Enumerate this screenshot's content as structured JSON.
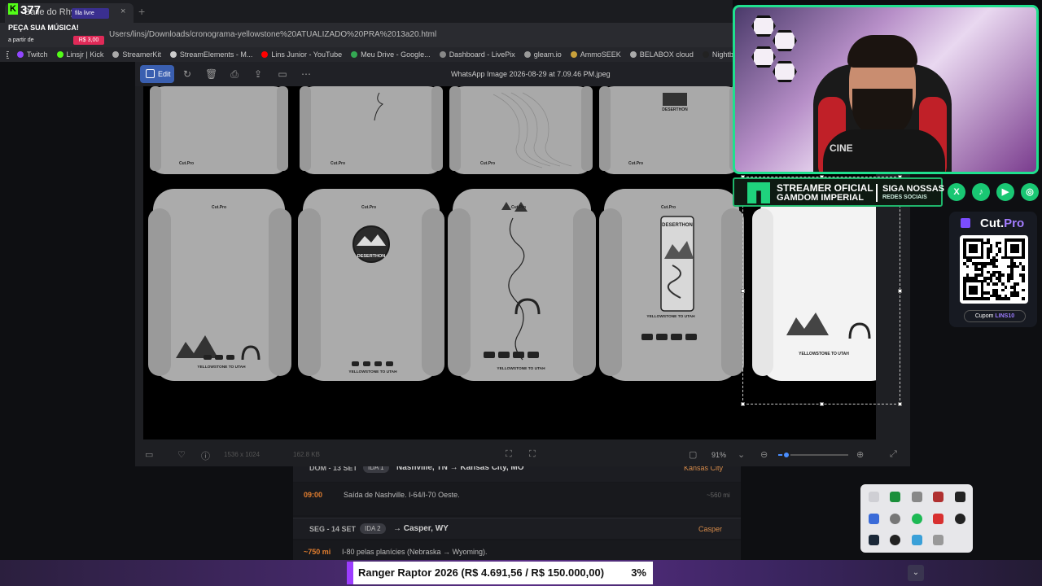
{
  "browser": {
    "tab_title": "Baile do Rhyno",
    "tab_close": "×",
    "tab_add": "+",
    "url": "Users/linsj/Downloads/cronograma-yellowstone%20ATUALIZADO%20PRA%2013a20.html",
    "bookmarks": [
      {
        "label": "Twitch",
        "color": "#9146ff"
      },
      {
        "label": "Linsjr | Kick",
        "color": "#53fc18"
      },
      {
        "label": "StreamerKit",
        "color": "#aaaaaa"
      },
      {
        "label": "StreamElements - M...",
        "color": "#cccccc"
      },
      {
        "label": "Lins Junior - YouTube",
        "color": "#ff0000"
      },
      {
        "label": "Meu Drive - Google...",
        "color": "#34a853"
      },
      {
        "label": "Dashboard - LivePix",
        "color": "#888888"
      },
      {
        "label": "gleam.io",
        "color": "#999999"
      },
      {
        "label": "AmmoSEEK",
        "color": "#c9a13b"
      },
      {
        "label": "BELABOX cloud",
        "color": "#aaaaaa"
      },
      {
        "label": "Nightbot - Comm...",
        "color": "#222222"
      }
    ]
  },
  "viewer": {
    "edit_label": "Edit",
    "title": "WhatsApp Image 2026-08-29 at 7.09.46 PM.jpeg",
    "dimensions": "1536 x 1024",
    "filesize": "162.8 KB",
    "zoom": "91%",
    "zoom_fraction": 0.12,
    "icons": [
      "rotate-icon",
      "delete-icon",
      "print-icon",
      "share-icon",
      "slideshow-icon",
      "more-icon"
    ]
  },
  "shirts": {
    "brand": "Cut.Pro",
    "badge_text": "DESERTHON",
    "print_text": "YELLOWSTONE TO UTAH"
  },
  "schedule": {
    "day1": {
      "day": "DOM - 13 SET",
      "pill": "IDA 1",
      "route": "Nashville, TN → Kansas City, MO",
      "city": "Kansas City"
    },
    "row1": {
      "time": "09:00",
      "desc": "Saída de Nashville. I-64/I-70 Oeste.",
      "dist": "~560 mi"
    },
    "day2": {
      "day": "SEG - 14 SET",
      "pill": "IDA 2",
      "route": "→ Casper, WY",
      "city": "Casper"
    },
    "row2": {
      "time": "~750 mi",
      "desc": "I-80 pelas planícies (Nebraska → Wyoming)."
    }
  },
  "overlay": {
    "kick_count": "377",
    "kick_icon": "K",
    "fila": "fila livre",
    "song_request": "PEÇA SUA MÚSICA!",
    "from_label": "a partir de",
    "price": "R$ 3,00"
  },
  "banner": {
    "line1": "STREAMER OFICIAL",
    "line2": "GAMDOM IMPERIAL",
    "line3": "SIGA NOSSAS",
    "line4": "REDES SOCIAIS",
    "socials": [
      "X",
      "♪",
      "▶",
      "◎"
    ]
  },
  "webcam": {
    "shirt_text": "CINE"
  },
  "cutpro": {
    "name_a": "Cut.",
    "name_b": "Pro",
    "coupon_label": "Cupom",
    "coupon_code": "LINS10"
  },
  "goal": {
    "text": "Ranger Raptor 2026 (R$ 4.691,56 / R$ 150.000,00)",
    "percent": "3%"
  },
  "colors": {
    "accent": "#1fe08e",
    "kick": "#53fc18",
    "edit_blue": "#3a5fb0",
    "goal_purple": "#9c3cff"
  }
}
